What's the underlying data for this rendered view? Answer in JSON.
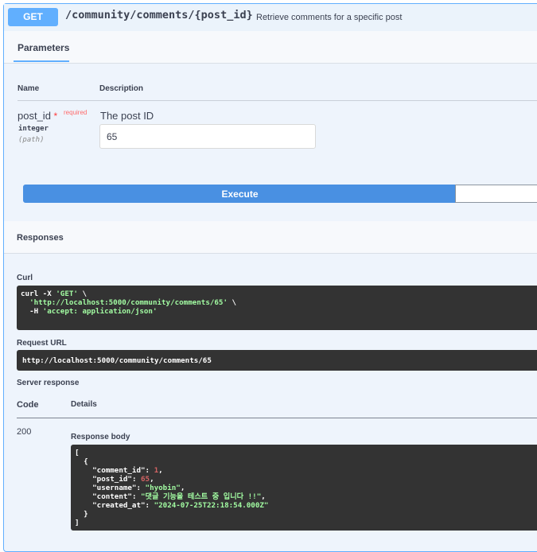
{
  "operation": {
    "method": "GET",
    "path": "/community/comments/{post_id}",
    "description": "Retrieve comments for a specific post"
  },
  "parameters": {
    "tab_label": "Parameters",
    "col_name": "Name",
    "col_description": "Description",
    "items": [
      {
        "name": "post_id",
        "required_star": "*",
        "required_label": "required",
        "type": "integer",
        "in": "(path)",
        "description": "The post ID",
        "value": "65"
      }
    ]
  },
  "execute_label": "Execute",
  "responses": {
    "title": "Responses",
    "curl_label": "Curl",
    "curl_line1_a": "curl -X ",
    "curl_line1_b": "'GET'",
    "curl_line1_c": " \\",
    "curl_line2_a": "  ",
    "curl_line2_b": "'http://localhost:5000/community/comments/65'",
    "curl_line2_c": " \\",
    "curl_line3_a": "  -H ",
    "curl_line3_b": "'accept: application/json'",
    "request_url_label": "Request URL",
    "request_url": "http://localhost:5000/community/comments/65",
    "server_response_label": "Server response",
    "col_code": "Code",
    "col_details": "Details",
    "status_code": "200",
    "response_body_label": "Response body",
    "body": {
      "open_bracket": "[",
      "open_brace": "  {",
      "fields": [
        {
          "key": "\"comment_id\"",
          "value": "1",
          "kind": "num",
          "comma": ","
        },
        {
          "key": "\"post_id\"",
          "value": "65",
          "kind": "num",
          "comma": ","
        },
        {
          "key": "\"username\"",
          "value": "\"hyobin\"",
          "kind": "str",
          "comma": ","
        },
        {
          "key": "\"content\"",
          "value": "\"댓글 기능을 테스트 중 입니다 !!\"",
          "kind": "str",
          "comma": ","
        },
        {
          "key": "\"created_at\"",
          "value": "\"2024-07-25T22:18:54.000Z\"",
          "kind": "str",
          "comma": ""
        }
      ],
      "close_brace": "  }",
      "close_bracket": "]"
    }
  },
  "colors": {
    "get_accent": "#61affe",
    "execute_blue": "#4990e2",
    "code_bg": "#333333",
    "string_green": "#a2fca2",
    "number_red": "#d36363"
  }
}
